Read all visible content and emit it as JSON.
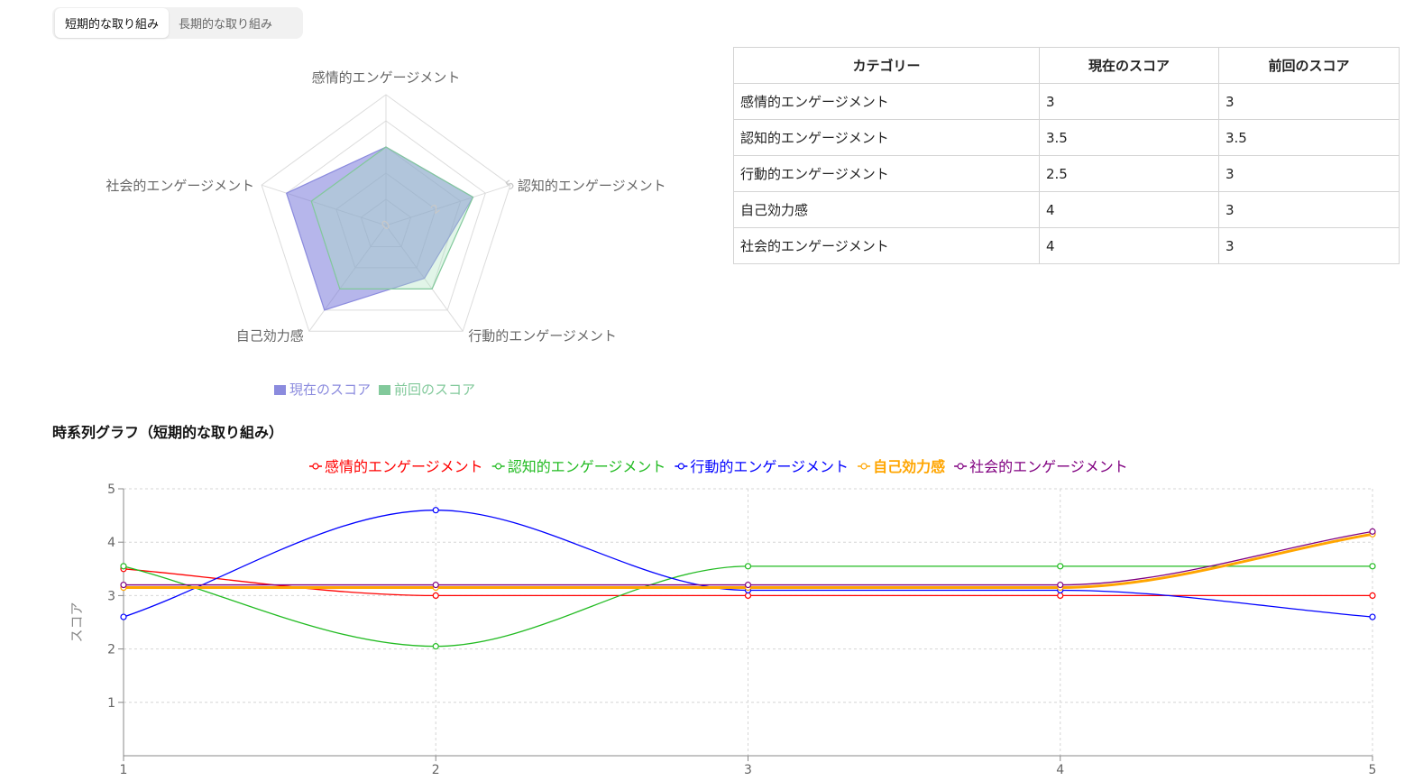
{
  "tabs": [
    {
      "label": "短期的な取り組み",
      "active": true
    },
    {
      "label": "長期的な取り組み",
      "active": false
    }
  ],
  "table": {
    "headers": [
      "カテゴリー",
      "現在のスコア",
      "前回のスコア"
    ],
    "rows": [
      [
        "感情的エンゲージメント",
        "3",
        "3"
      ],
      [
        "認知的エンゲージメント",
        "3.5",
        "3.5"
      ],
      [
        "行動的エンゲージメント",
        "2.5",
        "3"
      ],
      [
        "自己効力感",
        "4",
        "3"
      ],
      [
        "社会的エンゲージメント",
        "4",
        "3"
      ]
    ]
  },
  "section_title": "時系列グラフ（短期的な取り組み）",
  "chart_data": [
    {
      "type": "radar",
      "axes": [
        "感情的エンゲージメント",
        "認知的エンゲージメント",
        "行動的エンゲージメント",
        "自己効力感",
        "社会的エンゲージメント"
      ],
      "tick_labels": [
        "0",
        "2",
        "5"
      ],
      "range": [
        0,
        5
      ],
      "series": [
        {
          "name": "現在のスコア",
          "values": [
            3,
            3.5,
            2.5,
            4,
            4
          ],
          "color": "#8b8bde",
          "fill": "rgba(110,110,215,0.5)"
        },
        {
          "name": "前回のスコア",
          "values": [
            3,
            3.5,
            3,
            3,
            3
          ],
          "color": "#82c99b",
          "fill": "rgba(170,225,190,0.35)"
        }
      ],
      "legend_position": "bottom",
      "grid": true
    },
    {
      "type": "line",
      "x": [
        1,
        2,
        3,
        4,
        5
      ],
      "ylabel": "スコア",
      "ylim": [
        0,
        5
      ],
      "y_ticks": [
        "1",
        "2",
        "3",
        "4",
        "5"
      ],
      "x_ticks": [
        "1",
        "2",
        "3",
        "4",
        "5"
      ],
      "grid": true,
      "legend_position": "top",
      "series": [
        {
          "name": "感情的エンゲージメント",
          "values": [
            3.5,
            3,
            3,
            3,
            3
          ],
          "color": "#ff0000"
        },
        {
          "name": "認知的エンゲージメント",
          "values": [
            3.55,
            2.05,
            3.55,
            3.55,
            3.55
          ],
          "color": "#22bb22"
        },
        {
          "name": "行動的エンゲージメント",
          "values": [
            2.6,
            4.6,
            3.1,
            3.1,
            2.6
          ],
          "color": "#0000ff"
        },
        {
          "name": "自己効力感",
          "values": [
            3.15,
            3.15,
            3.15,
            3.15,
            4.15
          ],
          "color": "#ffa500"
        },
        {
          "name": "社会的エンゲージメント",
          "values": [
            3.2,
            3.2,
            3.2,
            3.2,
            4.2
          ],
          "color": "#800080"
        }
      ]
    }
  ]
}
